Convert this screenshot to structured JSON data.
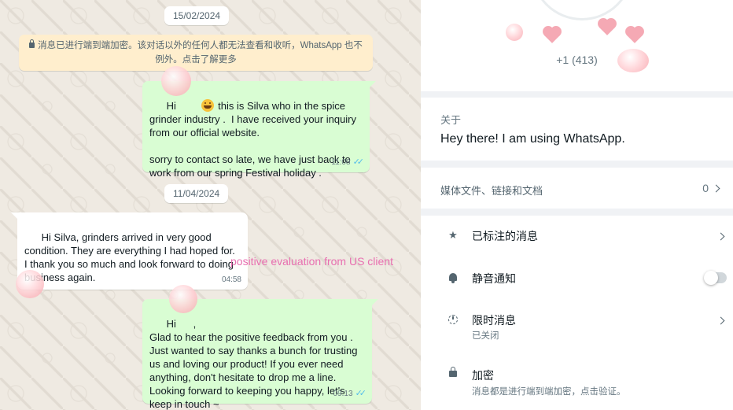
{
  "chat": {
    "date_1": "15/02/2024",
    "encryption_notice": "消息已进行端到端加密。该对话以外的任何人都无法查看和收听，WhatsApp 也不例外。点击了解更多",
    "msg_1": {
      "text_part1": "Hi ",
      "text_part2": " this is Silva who in the spice grinder industry .  I have received your inquiry from our official website.\n\nsorry to contact so late, we have just back to work from our spring Festival holiday .",
      "time": "11:08"
    },
    "date_2": "11/04/2024",
    "msg_2": {
      "text": "Hi Silva, grinders arrived in very good condition. They are everything I had hoped for. I thank you so much and look forward to doing business again.",
      "time": "04:58"
    },
    "overlay_label": "positive evaluation from US client",
    "msg_3": {
      "text": "Hi      ,\nGlad to hear the positive feedback from you .\nJust wanted to say thanks a bunch for trusting us and loving our product! If you ever need anything, don't hesitate to drop me a line. Looking forward to keeping you happy, let's keep in touch ~",
      "time": "09:13"
    }
  },
  "contact_info": {
    "phone": "+1 (413)",
    "about_title": "关于",
    "about_text": "Hey there! I am using WhatsApp.",
    "media_label": "媒体文件、链接和文档",
    "media_count": "0",
    "starred_label": "已标注的消息",
    "mute_label": "静音通知",
    "mute_on": false,
    "disappearing_label": "限时消息",
    "disappearing_status": "已关闭",
    "encryption_label": "加密",
    "encryption_sub": "消息都是进行端到端加密，点击验证。"
  },
  "colors": {
    "outgoing_bubble": "#d9fdd3",
    "incoming_bubble": "#ffffff",
    "read_ticks": "#53bdeb",
    "overlay_label": "#e86fb0"
  }
}
